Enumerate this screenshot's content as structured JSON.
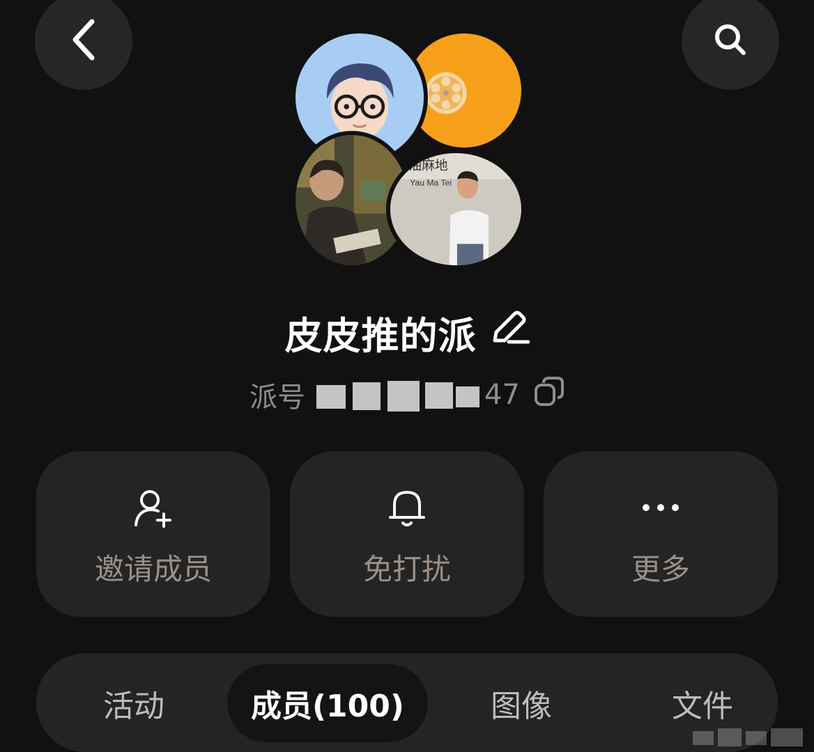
{
  "header": {
    "back_icon": "chevron-left-icon",
    "search_icon": "search-icon"
  },
  "group": {
    "name": "皮皮推的派",
    "edit_icon": "pencil-icon",
    "id_label": "派号",
    "id_visible_suffix": "47",
    "copy_icon": "copy-icon",
    "avatar_colors": [
      "#a8cdf5",
      "#f7a01a",
      "#5c5a3a",
      "#c9c5bd"
    ]
  },
  "actions": [
    {
      "label": "邀请成员",
      "icon": "user-plus-icon"
    },
    {
      "label": "免打扰",
      "icon": "bell-icon"
    },
    {
      "label": "更多",
      "icon": "more-dots-icon"
    }
  ],
  "tabs": [
    {
      "label": "活动"
    },
    {
      "label": "成员(100)",
      "selected": true
    },
    {
      "label": "图像"
    },
    {
      "label": "文件"
    }
  ],
  "colors": {
    "background": "#111111",
    "card": "#242424",
    "label_muted": "#9b9087"
  }
}
